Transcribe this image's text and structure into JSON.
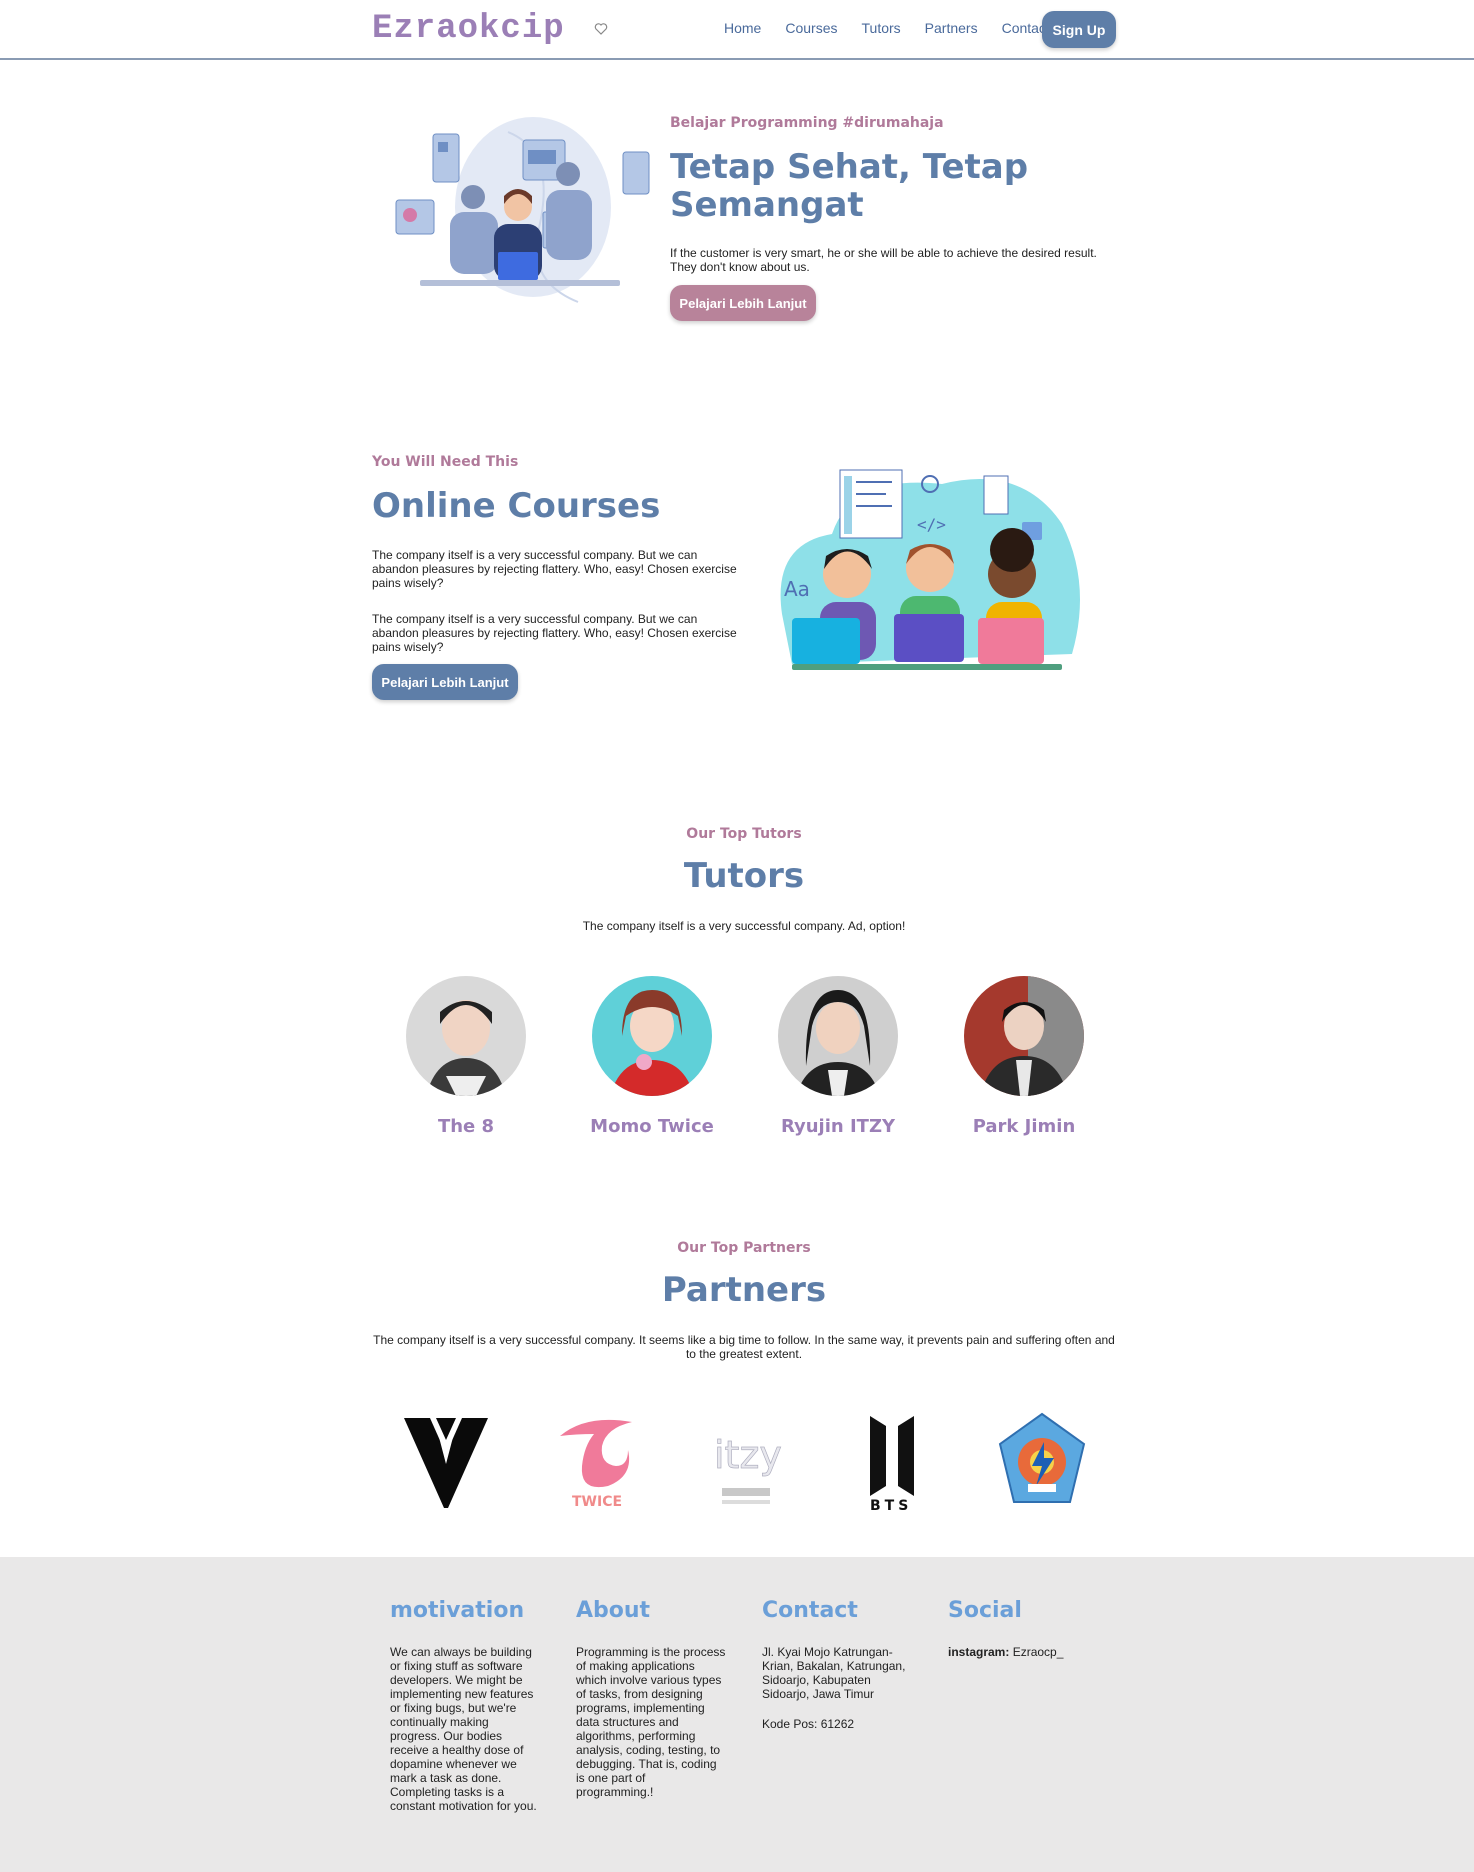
{
  "nav": {
    "brand": "Ezraokcip",
    "links": [
      "Home",
      "Courses",
      "Tutors",
      "Partners",
      "Contact"
    ],
    "signup": "Sign Up"
  },
  "hero": {
    "kicker": "Belajar Programming #dirumahaja",
    "title": "Tetap Sehat, Tetap Semangat",
    "description": "If the customer is very smart, he or she will be able to achieve the desired result. They don't know about us.",
    "button": "Pelajari Lebih Lanjut"
  },
  "courses": {
    "kicker": "You Will Need This",
    "title": "Online Courses",
    "paragraph1": "The company itself is a very successful company. But we can abandon pleasures by rejecting flattery. Who, easy! Chosen exercise pains wisely?",
    "paragraph2": "The company itself is a very successful company. But we can abandon pleasures by rejecting flattery. Who, easy! Chosen exercise pains wisely?",
    "button": "Pelajari Lebih Lanjut"
  },
  "tutors": {
    "kicker": "Our Top Tutors",
    "title": "Tutors",
    "description": "The company itself is a very successful company. Ad, option!",
    "list": [
      {
        "name": "The 8",
        "bg": "#d9d9d9"
      },
      {
        "name": "Momo Twice",
        "bg": "#5fd0d8"
      },
      {
        "name": "Ryujin ITZY",
        "bg": "#cfcfcf"
      },
      {
        "name": "Park Jimin",
        "bg": "#a5392d"
      }
    ]
  },
  "partners": {
    "kicker": "Our Top Partners",
    "title": "Partners",
    "description": "The company itself is a very successful company. It seems like a big time to follow. In the same way, it prevents pain and suffering often and to the greatest extent.",
    "logos": [
      "seventeen-logo",
      "twice-logo",
      "itzy-logo",
      "bts-logo",
      "school-logo"
    ],
    "twice_text": "TWICE",
    "itzy_text": "itzy",
    "bts_text": "BTS"
  },
  "footer": {
    "motivation_title": "motivation",
    "motivation_text": "We can always be building or fixing stuff as software developers. We might be implementing new features or fixing bugs, but we're continually making progress. Our bodies receive a healthy dose of dopamine whenever we mark a task as done. Completing tasks is a constant motivation for you.",
    "about_title": "About",
    "about_text": "Programming is the process of making applications which involve various types of tasks, from designing programs, implementing data structures and algorithms, performing analysis, coding, testing, to debugging. That is, coding is one part of programming.!",
    "contact_title": "Contact",
    "contact_address": "Jl. Kyai Mojo Katrungan-Krian, Bakalan, Katrungan, Sidoarjo, Kabupaten Sidoarjo, Jawa Timur",
    "contact_postal": "Kode Pos: 61262",
    "social_title": "Social",
    "social_label": "instagram:",
    "social_handle": "Ezraocp_"
  },
  "colors": {
    "primary": "#5e7ea8",
    "accent_pink": "#b8839a",
    "brand_purple": "#9b7fb6",
    "footer_bg": "#e9e8e8",
    "footer_heading": "#6b9fd8"
  }
}
